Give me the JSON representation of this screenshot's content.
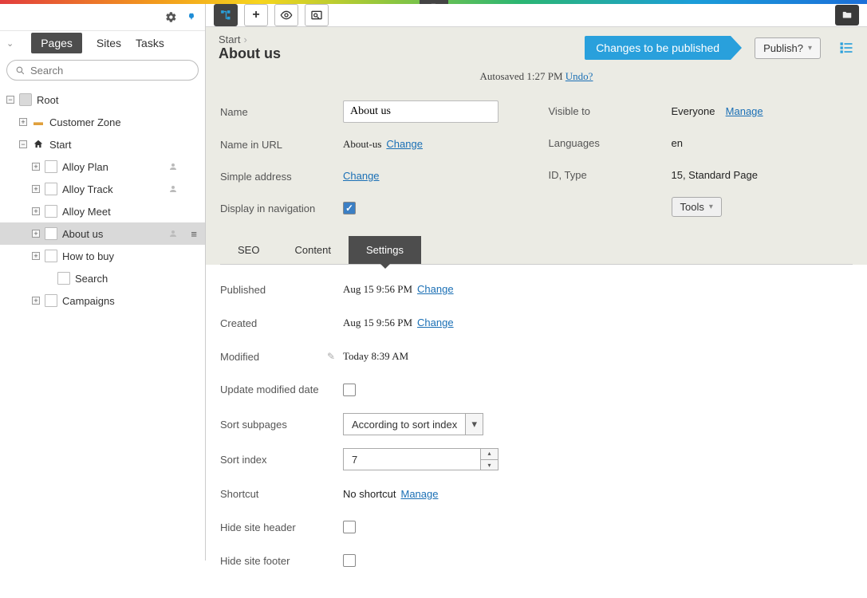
{
  "sidebar": {
    "tabs": [
      "Pages",
      "Sites",
      "Tasks"
    ],
    "active_tab": 0,
    "search_placeholder": "Search",
    "tree": [
      {
        "label": "Root",
        "type": "root",
        "indent": 0,
        "expand": "minus"
      },
      {
        "label": "Customer Zone",
        "type": "folder",
        "indent": 1,
        "expand": "plus"
      },
      {
        "label": "Start",
        "type": "home",
        "indent": 1,
        "expand": "minus"
      },
      {
        "label": "Alloy Plan",
        "type": "page",
        "indent": 2,
        "expand": "plus",
        "person": true
      },
      {
        "label": "Alloy Track",
        "type": "page",
        "indent": 2,
        "expand": "plus",
        "person": true
      },
      {
        "label": "Alloy Meet",
        "type": "page",
        "indent": 2,
        "expand": "plus"
      },
      {
        "label": "About us",
        "type": "page",
        "indent": 2,
        "expand": "plus",
        "person": true,
        "selected": true
      },
      {
        "label": "How to buy",
        "type": "page",
        "indent": 2,
        "expand": "plus"
      },
      {
        "label": "Search",
        "type": "page",
        "indent": 3,
        "expand": "none"
      },
      {
        "label": "Campaigns",
        "type": "page",
        "indent": 2,
        "expand": "plus"
      }
    ]
  },
  "header": {
    "breadcrumb_parent": "Start",
    "title": "About us",
    "status": "Changes to be published",
    "publish_label": "Publish?",
    "autosave_prefix": "Autosaved",
    "autosave_time": "1:27 PM",
    "undo": "Undo?"
  },
  "form_top": {
    "name_label": "Name",
    "name_value": "About us",
    "url_label": "Name in URL",
    "url_value": "About-us",
    "url_link": "Change",
    "simple_label": "Simple address",
    "simple_link": "Change",
    "nav_label": "Display in navigation",
    "nav_checked": true,
    "visible_label": "Visible to",
    "visible_value": "Everyone",
    "visible_link": "Manage",
    "lang_label": "Languages",
    "lang_value": "en",
    "id_label": "ID, Type",
    "id_value": "15, Standard Page",
    "tools_label": "Tools"
  },
  "content_tabs": [
    "SEO",
    "Content",
    "Settings"
  ],
  "content_tab_active": 2,
  "settings": {
    "published_label": "Published",
    "published_value": "Aug 15 9:56 PM",
    "published_link": "Change",
    "created_label": "Created",
    "created_value": "Aug 15 9:56 PM",
    "created_link": "Change",
    "modified_label": "Modified",
    "modified_value": "Today 8:39 AM",
    "update_label": "Update modified date",
    "update_checked": false,
    "sort_label": "Sort subpages",
    "sort_value": "According to sort index",
    "index_label": "Sort index",
    "index_value": "7",
    "shortcut_label": "Shortcut",
    "shortcut_value": "No shortcut",
    "shortcut_link": "Manage",
    "hide_header_label": "Hide site header",
    "hide_header_checked": false,
    "hide_footer_label": "Hide site footer",
    "hide_footer_checked": false
  }
}
